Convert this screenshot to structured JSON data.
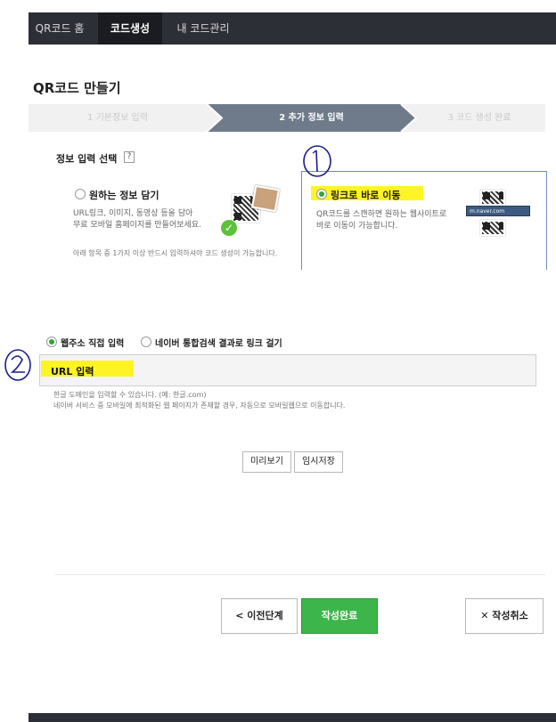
{
  "nav": {
    "items": [
      "QR코드 홈",
      "코드생성",
      "내 코드관리"
    ],
    "active_index": 1
  },
  "page": {
    "title": "QR코드 만들기"
  },
  "steps": [
    "1 기본정보 입력",
    "2 추가 정보 입력",
    "3 코드 생성 완료"
  ],
  "active_step": 1,
  "info_select": {
    "title": "정보 입력 선택",
    "help": "?"
  },
  "options": {
    "left": {
      "title": "원하는 정보 담기",
      "desc1": "URL링크, 이미지, 동영상 등을 담아",
      "desc2": "무료 모바일 홈페이지를 만들어보세요.",
      "note": "아래 항목 중 1가지 이상 반드시 입력하셔야 코드 생성이 가능합니다.",
      "selected": false
    },
    "right": {
      "title": "링크로 바로 이동",
      "desc1": "QR코드를 스캔하면 원하는 웹사이트로",
      "desc2": "바로 이동이 가능합니다.",
      "url_sample": "m.naver.com",
      "selected": true
    }
  },
  "link_type": {
    "direct": "웹주소 직접 입력",
    "search": "네이버 통합검색 결과로 링크 걸기",
    "selected": "direct"
  },
  "url_field": {
    "label": "URL 입력",
    "value": ""
  },
  "hints": [
    "한글 도메인을 입력할 수 있습니다. (예: 한글.com)",
    "네이버 서비스 중 모바일에 최적화된 웹 페이지가 존재할 경우, 자동으로 모바일웹으로 이동합니다."
  ],
  "buttons": {
    "preview": "미리보기",
    "save_temp": "임시저장",
    "prev": "< 이전단계",
    "complete": "작성완료",
    "cancel": "✕ 작성취소"
  },
  "annotations": [
    "1",
    "2"
  ],
  "colors": {
    "nav_bg": "#2d2f36",
    "step_active": "#6f7b8a",
    "green": "#3cb54a",
    "highlight": "#fff200"
  }
}
